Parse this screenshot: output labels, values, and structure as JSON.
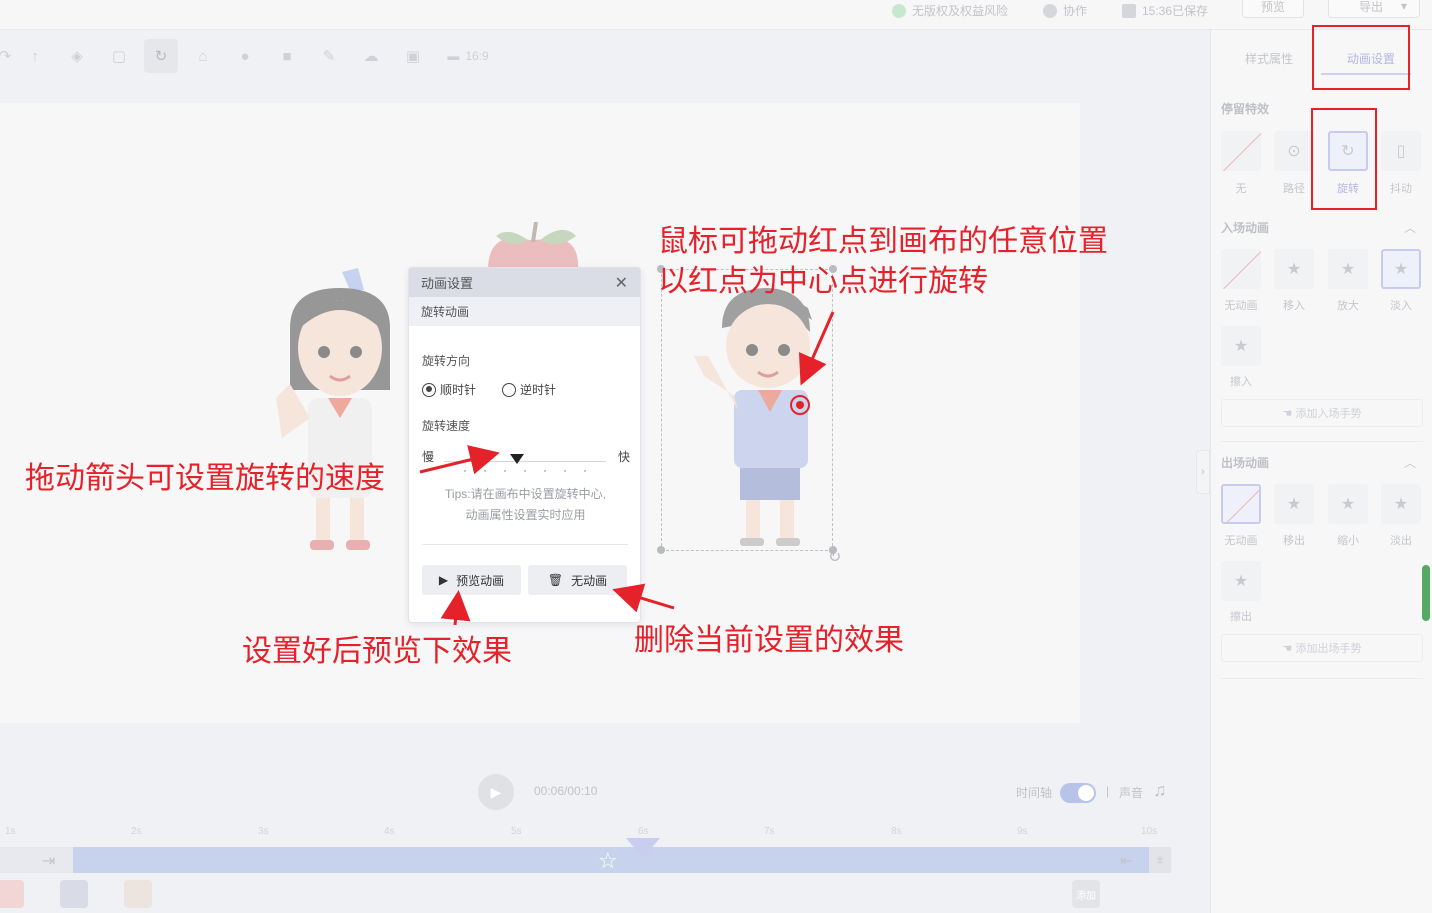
{
  "topbar": {
    "copyright": "无版权及权益风险",
    "collab": "协作",
    "saved": "15:36已保存",
    "preview": "预览",
    "export": "导出"
  },
  "toolbar": {
    "ratio": "16:9"
  },
  "dialog": {
    "title": "动画设置",
    "close": "✕",
    "subtitle": "旋转动画",
    "direction_label": "旋转方向",
    "clockwise": "顺时针",
    "counterclockwise": "逆时针",
    "speed_label": "旋转速度",
    "slow": "慢",
    "fast": "快",
    "speed_level": 0.45,
    "tips_line1": "Tips:请在画布中设置旋转中心,",
    "tips_line2": "动画属性设置实时应用",
    "preview_btn": "预览动画",
    "none_btn": "无动画"
  },
  "annotations": {
    "center_line1": "鼠标可拖动红点到画布的任意位置",
    "center_line2": "以红点为中心点进行旋转",
    "speed": "拖动箭头可设置旋转的速度",
    "preview": "设置好后预览下效果",
    "delete": "删除当前设置的效果"
  },
  "right_panel": {
    "tab_style": "样式属性",
    "tab_anim": "动画设置",
    "stay_title": "停留特效",
    "stay_effects": [
      "无",
      "路径",
      "旋转",
      "抖动"
    ],
    "enter_title": "入场动画",
    "enter_effects": [
      "无动画",
      "移入",
      "放大",
      "淡入",
      "擦入"
    ],
    "enter_gesture": "添加入场手势",
    "exit_title": "出场动画",
    "exit_effects": [
      "无动画",
      "移出",
      "缩小",
      "淡出",
      "擦出"
    ],
    "exit_gesture": "添加出场手势"
  },
  "timeline": {
    "timecode": "00:06/00:10",
    "timeline_label": "时间轴",
    "separator": "|",
    "sound_label": "声音",
    "ticks": [
      "1s",
      "2s",
      "3s",
      "4s",
      "5s",
      "6s",
      "7s",
      "8s",
      "9s",
      "10s"
    ],
    "end_label": "添加"
  },
  "icons": {
    "play": "play-icon",
    "star": "star-icon",
    "music": "music-note-icon"
  },
  "colors": {
    "annotation_red": "#e5212a",
    "track": "#c7d3ec",
    "accent": "#c9cdf0"
  }
}
